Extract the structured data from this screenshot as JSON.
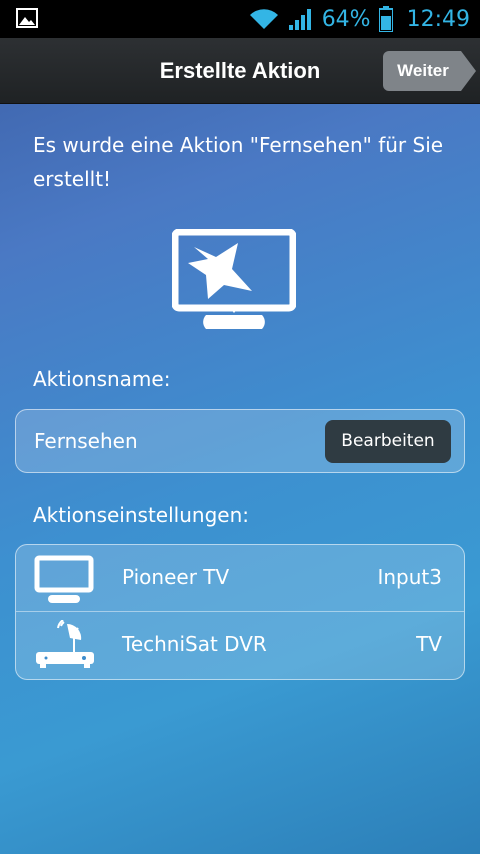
{
  "status_bar": {
    "left_icon": "image-icon",
    "wifi_icon": "wifi-icon",
    "signal_icon": "signal-icon",
    "battery_percent": "64%",
    "battery_icon": "battery-icon",
    "time": "12:49",
    "accent_color": "#33b5e5"
  },
  "app_bar": {
    "title": "Erstellte Aktion",
    "next_label": "Weiter"
  },
  "intro": {
    "text": "Es wurde eine Aktion \"Fernsehen\" für Sie erstellt!",
    "icon": "tv-star-icon"
  },
  "action_name": {
    "label": "Aktionsname:",
    "value": "Fernsehen",
    "edit_label": "Bearbeiten"
  },
  "action_settings": {
    "label": "Aktionseinstellungen:",
    "devices": [
      {
        "icon": "tv-icon",
        "name": "Pioneer TV",
        "value": "Input3"
      },
      {
        "icon": "satellite-receiver-icon",
        "name": "TechniSat DVR",
        "value": "TV"
      }
    ]
  }
}
